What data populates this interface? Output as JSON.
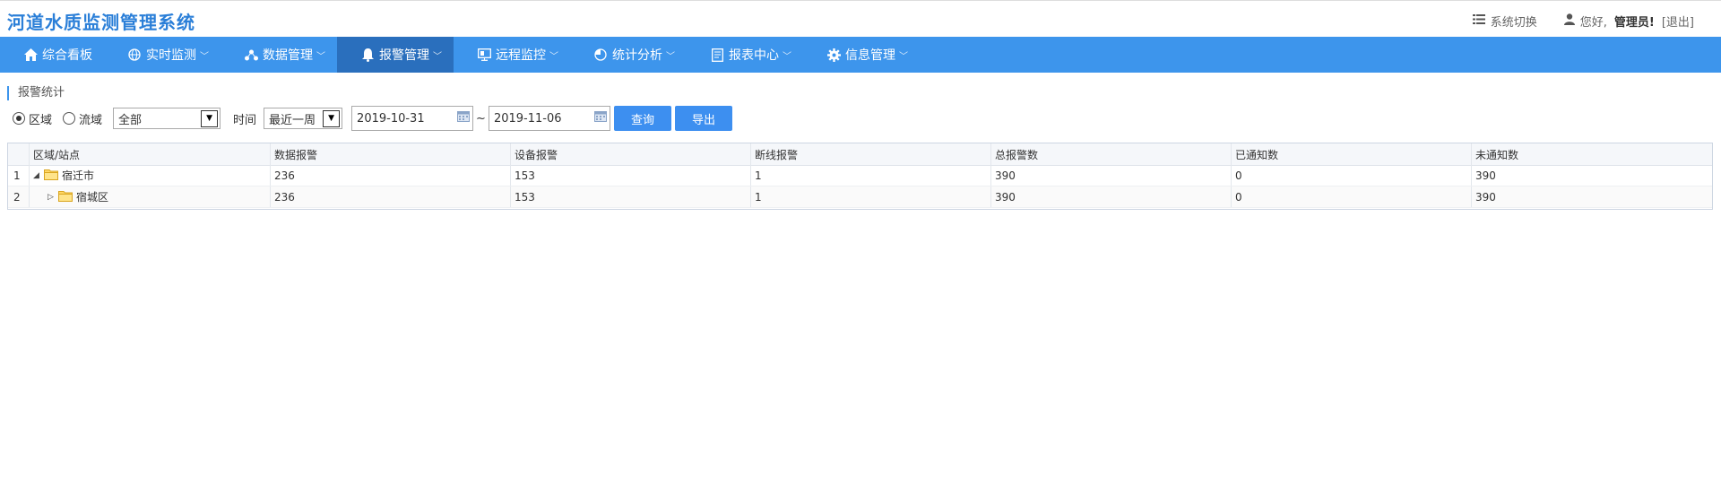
{
  "app": {
    "title": "河道水质监测管理系统"
  },
  "header": {
    "system_switch": "系统切换",
    "greeting": "您好,",
    "user": "管理员!",
    "logout": "[退出]"
  },
  "nav": {
    "items": [
      {
        "label": "综合看板",
        "icon": "home-icon",
        "has_dropdown": false
      },
      {
        "label": "实时监测",
        "icon": "globe-icon",
        "has_dropdown": true
      },
      {
        "label": "数据管理",
        "icon": "share-nodes-icon",
        "has_dropdown": true
      },
      {
        "label": "报警管理",
        "icon": "bell-icon",
        "has_dropdown": true,
        "active": true
      },
      {
        "label": "远程监控",
        "icon": "monitor-icon",
        "has_dropdown": true
      },
      {
        "label": "统计分析",
        "icon": "pie-chart-icon",
        "has_dropdown": true
      },
      {
        "label": "报表中心",
        "icon": "report-icon",
        "has_dropdown": true
      },
      {
        "label": "信息管理",
        "icon": "gear-icon",
        "has_dropdown": true
      }
    ],
    "accent_color": "#3d95ec",
    "active_color": "#2a6fbd"
  },
  "page": {
    "title": "报警统计"
  },
  "filter": {
    "radio_region": "区域",
    "radio_basin": "流域",
    "region_selected": true,
    "area_select": "全部",
    "time_label": "时间",
    "time_select": "最近一周",
    "date_from": "2019-10-31",
    "tilde": "~",
    "date_to": "2019-11-06",
    "query_button": "查询",
    "export_button": "导出"
  },
  "table": {
    "columns": [
      "区域/站点",
      "数据报警",
      "设备报警",
      "断线报警",
      "总报警数",
      "已通知数",
      "未通知数"
    ],
    "rows": [
      {
        "index": "1",
        "name": "宿迁市",
        "expanded": true,
        "data_alarm": "236",
        "device_alarm": "153",
        "offline_alarm": "1",
        "total": "390",
        "notified": "0",
        "not_notified": "390"
      },
      {
        "index": "2",
        "name": "宿城区",
        "expanded": false,
        "data_alarm": "236",
        "device_alarm": "153",
        "offline_alarm": "1",
        "total": "390",
        "notified": "0",
        "not_notified": "390"
      }
    ]
  }
}
